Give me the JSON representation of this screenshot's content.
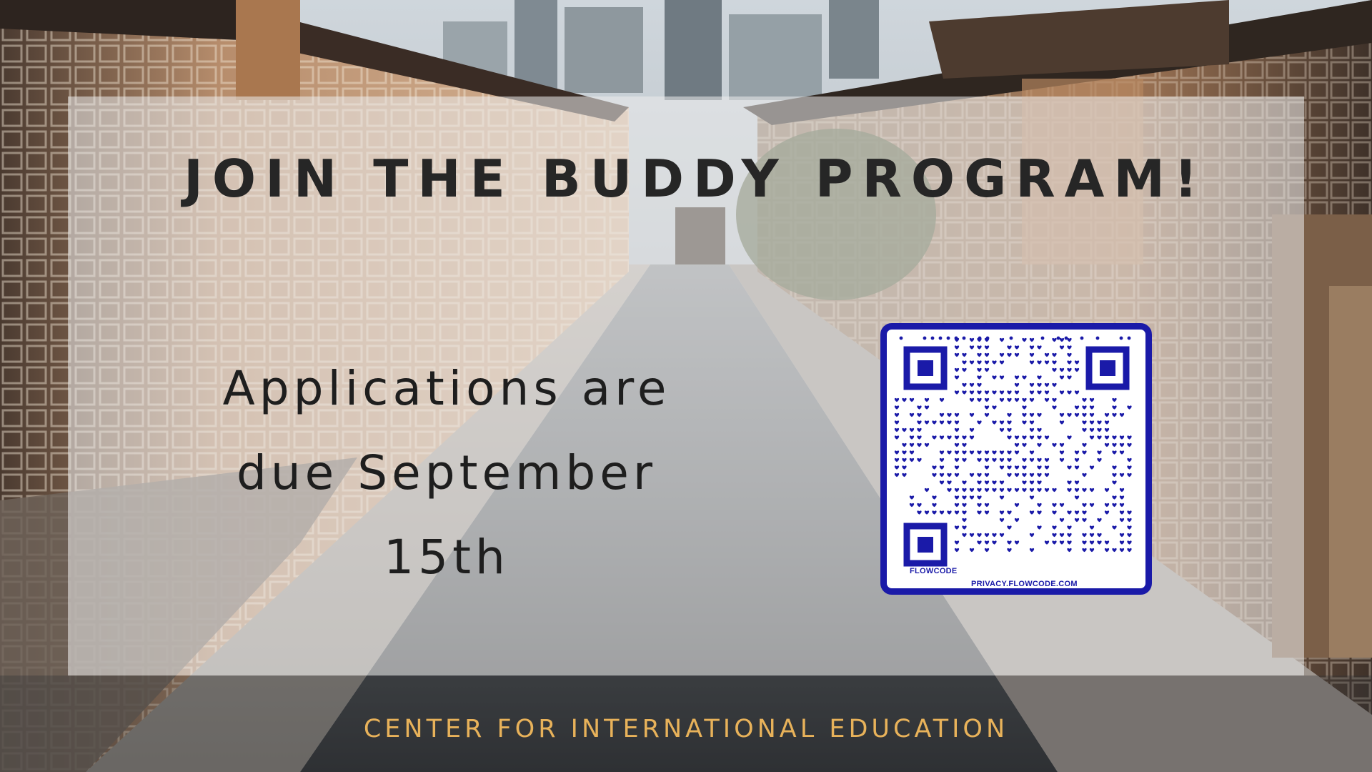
{
  "poster": {
    "headline": "JOIN THE BUDDY PROGRAM!",
    "body_lines": [
      "Applications are",
      "due September",
      "15th"
    ],
    "footer": "CENTER FOR INTERNATIONAL EDUCATION"
  },
  "qr_code": {
    "brand_label": "FLOWCODE",
    "privacy_label": "PRIVACY.FLOWCODE.COM",
    "accent_color": "#1a1aa8"
  },
  "colors": {
    "headline": "#262626",
    "body": "#1e1e1e",
    "footer": "#e8b25a",
    "panel": "rgba(236,236,236,0.56)"
  },
  "background": {
    "scene": "hanok-village-alley-photo"
  }
}
